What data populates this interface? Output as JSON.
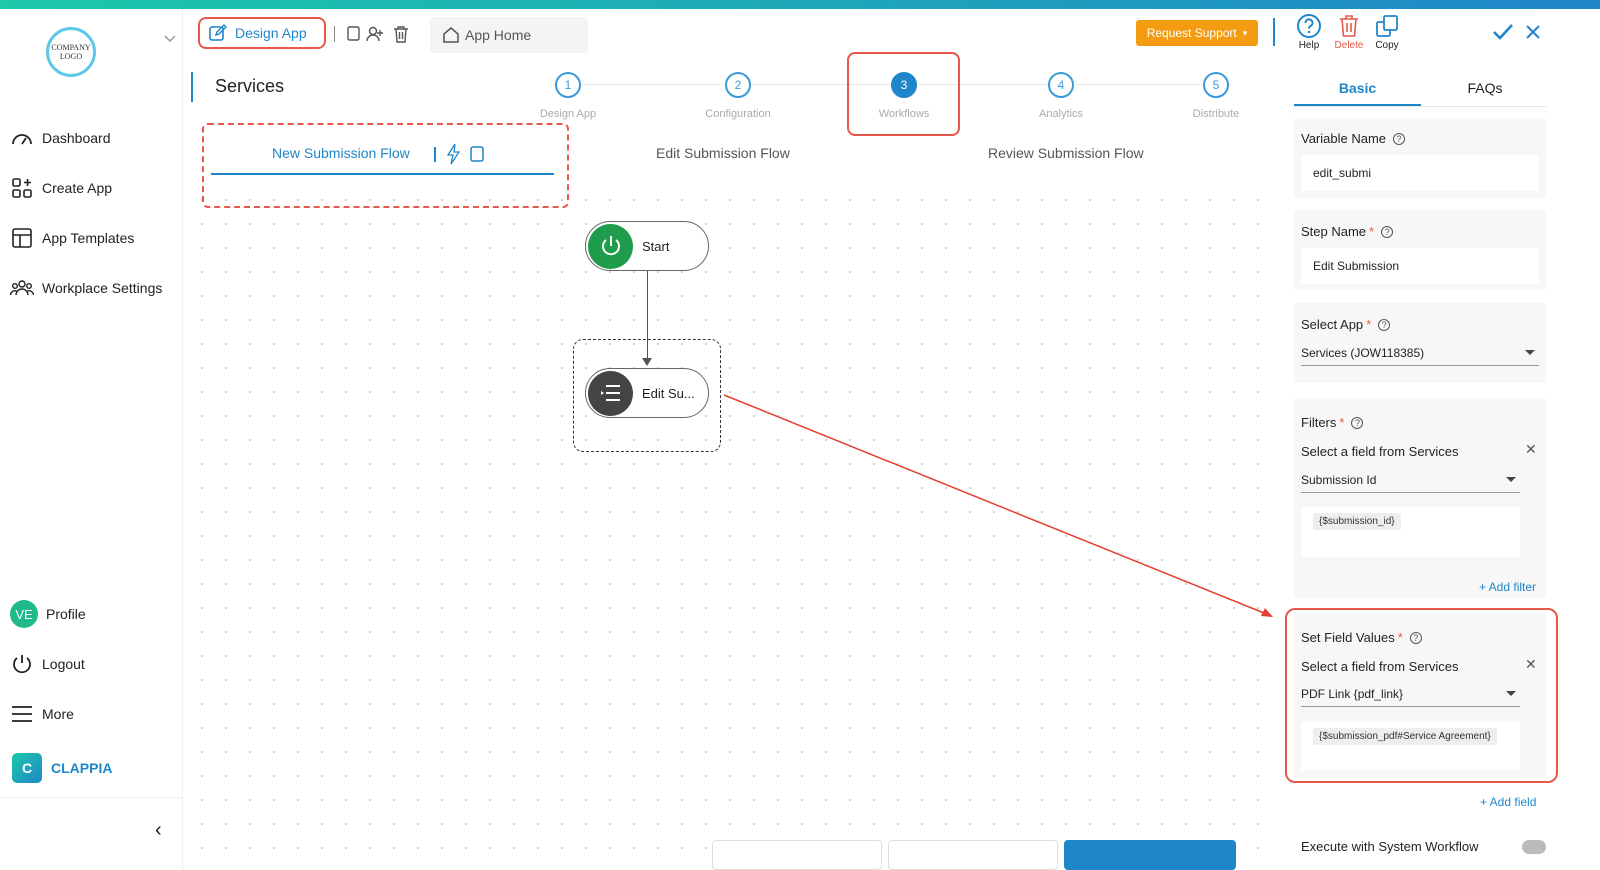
{
  "sidebar": {
    "logo_text": "COMPANY LOGO",
    "items": [
      {
        "label": "Dashboard",
        "icon": "gauge-icon"
      },
      {
        "label": "Create App",
        "icon": "apps-plus-icon"
      },
      {
        "label": "App Templates",
        "icon": "template-icon"
      },
      {
        "label": "Workplace Settings",
        "icon": "users-icon"
      }
    ],
    "bottom_items": [
      {
        "label": "Profile",
        "avatar": "VE"
      },
      {
        "label": "Logout",
        "icon": "power-icon"
      },
      {
        "label": "More",
        "icon": "menu-icon"
      }
    ],
    "brand": "CLAPPIA",
    "collapse_glyph": "‹"
  },
  "header": {
    "design_app_label": "Design App",
    "app_home_label": "App Home",
    "request_support_label": "Request Support",
    "request_support_caret": "▾"
  },
  "page": {
    "title": "Services"
  },
  "stepper": {
    "steps": [
      {
        "num": "1",
        "label": "Design App"
      },
      {
        "num": "2",
        "label": "Configuration"
      },
      {
        "num": "3",
        "label": "Workflows",
        "active": true
      },
      {
        "num": "4",
        "label": "Analytics"
      },
      {
        "num": "5",
        "label": "Distribute"
      }
    ]
  },
  "flow_tabs": [
    {
      "label": "New Submission Flow",
      "active": true
    },
    {
      "label": "Edit Submission Flow"
    },
    {
      "label": "Review Submission Flow"
    }
  ],
  "canvas": {
    "start_node_label": "Start",
    "edit_node_label": "Edit Su..."
  },
  "right_panel": {
    "actions": [
      {
        "label": "Help",
        "icon": "help-icon"
      },
      {
        "label": "Delete",
        "icon": "trash-icon"
      },
      {
        "label": "Copy",
        "icon": "copy-icon"
      }
    ],
    "tabs": [
      "Basic",
      "FAQs"
    ],
    "variable_name_label": "Variable Name",
    "variable_name_value": "edit_submi",
    "step_name_label": "Step Name",
    "step_name_value": "Edit Submission",
    "select_app_label": "Select App",
    "select_app_value": "Services (JOW118385)",
    "filters_label": "Filters",
    "filters_select_label": "Select a field from Services",
    "filters_field_value": "Submission Id",
    "filters_chip": "{$submission_id}",
    "add_filter_label": "+ Add filter",
    "set_field_values_label": "Set Field Values",
    "sfv_select_label": "Select a field from Services",
    "sfv_field_value": "PDF Link {pdf_link}",
    "sfv_chip": "{$submission_pdf#Service Agreement}",
    "add_field_label": "+ Add field",
    "execute_label": "Execute with System Workflow",
    "required_mark": "*",
    "help_mark": "?",
    "remove_glyph": "✕"
  },
  "colors": {
    "accent": "#1f86c9",
    "highlight": "#e5584a",
    "support": "#f39c12",
    "start_node": "#1f9d4c"
  }
}
